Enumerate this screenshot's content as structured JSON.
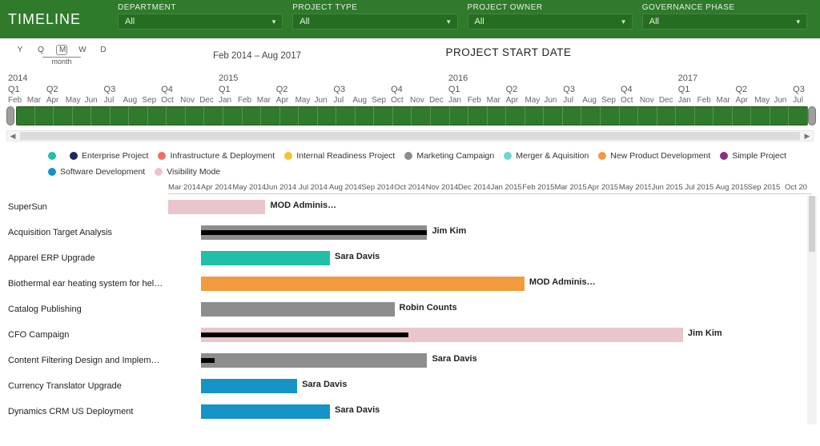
{
  "title": "TIMELINE",
  "filters": [
    {
      "label": "DEPARTMENT",
      "value": "All"
    },
    {
      "label": "PROJECT TYPE",
      "value": "All"
    },
    {
      "label": "PROJECT OWNER",
      "value": "All"
    },
    {
      "label": "GOVERNANCE PHASE",
      "value": "All"
    }
  ],
  "zoom": {
    "options": [
      "Y",
      "Q",
      "M",
      "W",
      "D"
    ],
    "active": "M",
    "caption": "month",
    "range_label": "Feb 2014 – Aug 2017"
  },
  "axis_title": "PROJECT START DATE",
  "legend": [
    {
      "name": "",
      "color": "#1fbfa8"
    },
    {
      "name": "Enterprise Project",
      "color": "#1d2856"
    },
    {
      "name": "Infrastructure & Deployment",
      "color": "#f06e6a"
    },
    {
      "name": "Internal Readiness Project",
      "color": "#f3c431"
    },
    {
      "name": "Marketing Campaign",
      "color": "#8d8d8d"
    },
    {
      "name": "Merger & Aquisition",
      "color": "#6fd5d5"
    },
    {
      "name": "New Product Development",
      "color": "#f39a3e"
    },
    {
      "name": "Simple Project",
      "color": "#8b2f82"
    },
    {
      "name": "Software Development",
      "color": "#1593c6"
    },
    {
      "name": "Visibility Mode",
      "color": "#e9c6cc"
    }
  ],
  "gantt_months": [
    "Mar 2014",
    "Apr 2014",
    "May 2014",
    "Jun 2014",
    "Jul 2014",
    "Aug 2014",
    "Sep 2014",
    "Oct 2014",
    "Nov 2014",
    "Dec 2014",
    "Jan 2015",
    "Feb 2015",
    "Mar 2015",
    "Apr 2015",
    "May 2015",
    "Jun 2015",
    "Jul 2015",
    "Aug 2015",
    "Sep 2015",
    "Oct 20"
  ],
  "chart_data": {
    "type": "bar",
    "title": "PROJECT START DATE",
    "x_range": [
      "2014-03",
      "2015-10"
    ],
    "categories": [
      "SuperSun",
      "Acquisition Target Analysis",
      "Apparel ERP Upgrade",
      "Biothermal ear heating system for helmets",
      "Catalog Publishing",
      "CFO Campaign",
      "Content Filtering Design and Implementa…",
      "Currency Translator Upgrade",
      "Dynamics CRM US Deployment"
    ],
    "series": [
      {
        "name": "SuperSun",
        "owner": "MOD Adminis…",
        "type": "Visibility Mode",
        "color": "#e9c6cc",
        "start": "2014-03",
        "end": "2014-06"
      },
      {
        "name": "Acquisition Target Analysis",
        "owner": "Jim Kim",
        "type": "Marketing Campaign",
        "color": "#8d8d8d",
        "start": "2014-04",
        "end": "2014-11",
        "overlay_end_fraction": 1.0
      },
      {
        "name": "Apparel ERP Upgrade",
        "owner": "Sara Davis",
        "type": "(teal)",
        "color": "#1fbfa8",
        "start": "2014-04",
        "end": "2014-08"
      },
      {
        "name": "Biothermal ear heating system for helmets",
        "owner": "MOD Adminis…",
        "type": "New Product Development",
        "color": "#f39a3e",
        "start": "2014-04",
        "end": "2015-02"
      },
      {
        "name": "Catalog Publishing",
        "owner": "Robin Counts",
        "type": "Marketing Campaign",
        "color": "#8d8d8d",
        "start": "2014-04",
        "end": "2014-10"
      },
      {
        "name": "CFO Campaign",
        "owner": "Jim Kim",
        "type": "Visibility Mode",
        "color": "#e9c6cc",
        "start": "2014-04",
        "end": "2015-07",
        "overlay_end_fraction": 0.43
      },
      {
        "name": "Content Filtering Design and Implementa…",
        "owner": "Sara Davis",
        "type": "Marketing Campaign",
        "color": "#8d8d8d",
        "start": "2014-04",
        "end": "2014-11",
        "overlay_end_fraction": 0.06
      },
      {
        "name": "Currency Translator Upgrade",
        "owner": "Sara Davis",
        "type": "Software Development",
        "color": "#1593c6",
        "start": "2014-04",
        "end": "2014-07"
      },
      {
        "name": "Dynamics CRM US Deployment",
        "owner": "Sara Davis",
        "type": "Software Development",
        "color": "#1593c6",
        "start": "2014-04",
        "end": "2014-08"
      }
    ]
  },
  "top_axis": {
    "years": [
      {
        "y": "2014",
        "months": [
          "Feb",
          "Mar",
          "Apr",
          "May",
          "Jun",
          "Jul",
          "Aug",
          "Sep",
          "Oct",
          "Nov",
          "Dec"
        ]
      },
      {
        "y": "2015",
        "months": [
          "Jan",
          "Feb",
          "Mar",
          "Apr",
          "May",
          "Jun",
          "Jul",
          "Aug",
          "Sep",
          "Oct",
          "Nov",
          "Dec"
        ]
      },
      {
        "y": "2016",
        "months": [
          "Jan",
          "Feb",
          "Mar",
          "Apr",
          "May",
          "Jun",
          "Jul",
          "Aug",
          "Sep",
          "Oct",
          "Nov",
          "Dec"
        ]
      },
      {
        "y": "2017",
        "months": [
          "Jan",
          "Feb",
          "Mar",
          "Apr",
          "May",
          "Jun",
          "Jul"
        ]
      }
    ],
    "quarters": [
      "Q1",
      "Q2",
      "Q3",
      "Q4",
      "Q1",
      "Q2",
      "Q3",
      "Q4",
      "Q1",
      "Q2",
      "Q3",
      "Q4",
      "Q1",
      "Q2",
      "Q3"
    ]
  }
}
